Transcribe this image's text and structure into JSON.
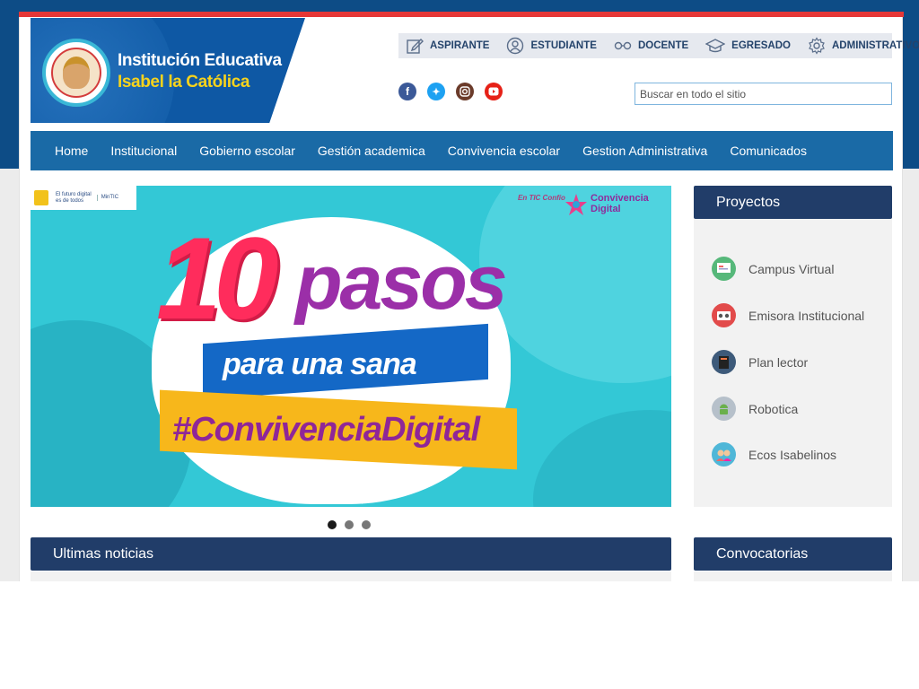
{
  "institution": {
    "line1": "Institución Educativa",
    "line2": "Isabel la Católica"
  },
  "roles": [
    {
      "label": "ASPIRANTE",
      "icon": "edit-icon"
    },
    {
      "label": "ESTUDIANTE",
      "icon": "user-icon"
    },
    {
      "label": "DOCENTE",
      "icon": "glasses-icon"
    },
    {
      "label": "EGRESADO",
      "icon": "graduation-cap-icon"
    },
    {
      "label": "ADMINISTRATIVO",
      "icon": "gear-icon"
    }
  ],
  "social": [
    {
      "name": "facebook-icon",
      "glyph": "f",
      "color": "#3b5998"
    },
    {
      "name": "twitter-icon",
      "glyph": "t",
      "color": "#1da1f2"
    },
    {
      "name": "instagram-icon",
      "glyph": "◎",
      "color": "#6b3b2a"
    },
    {
      "name": "youtube-icon",
      "glyph": "▶",
      "color": "#e62117"
    }
  ],
  "search": {
    "placeholder": "Buscar en todo el sitio"
  },
  "nav": [
    "Home",
    "Institucional",
    "Gobierno escolar",
    "Gestión academica",
    "Convivencia escolar",
    "Gestion Administrativa",
    "Comunicados"
  ],
  "slide": {
    "number": "10",
    "word": "pasos",
    "subtitle": "para una sana",
    "hashtag": "#ConvivenciaDigital",
    "gov_text_1": "El futuro digital",
    "gov_text_2": "es de todos",
    "gov_ministry": "MinTIC",
    "brand_1": "Convivencia",
    "brand_2": "Digital",
    "small_brand": "En TIC Confío"
  },
  "slider_dots": {
    "count": 3,
    "active": 1
  },
  "projects_panel": {
    "title": "Proyectos",
    "items": [
      {
        "label": "Campus Virtual",
        "icon": "campus-icon",
        "color": "#56b87a"
      },
      {
        "label": "Emisora Institucional",
        "icon": "radio-icon",
        "color": "#e24b4b"
      },
      {
        "label": "Plan lector",
        "icon": "book-icon",
        "color": "#3d5a7a"
      },
      {
        "label": "Robotica",
        "icon": "android-icon",
        "color": "#9aa6b2"
      },
      {
        "label": "Ecos Isabelinos",
        "icon": "people-icon",
        "color": "#4fb7d8"
      }
    ]
  },
  "news": {
    "title": "Ultimas noticias"
  },
  "calls": {
    "title": "Convocatorias"
  },
  "colors": {
    "navy": "#213d69",
    "nav_blue": "#1a6aa6",
    "accent_red": "#e63737",
    "yellow": "#f7d31c"
  }
}
